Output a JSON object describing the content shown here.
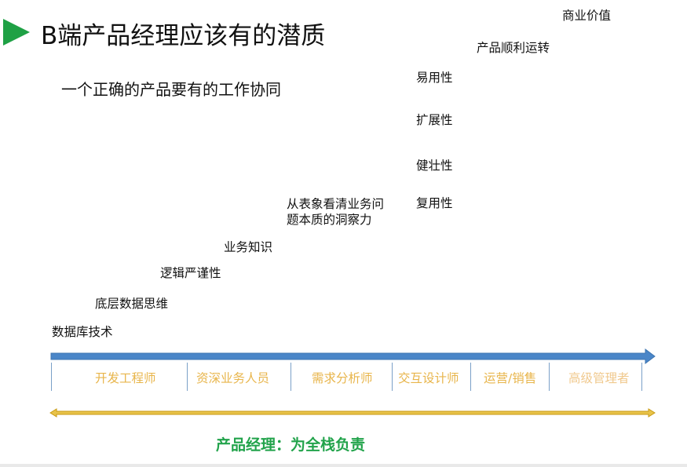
{
  "slide": {
    "title": "B端产品经理应该有的潜质",
    "subtitle": "一个正确的产品要有的工作协同"
  },
  "skills": [
    "数据库技术",
    "底层数据思维",
    "逻辑严谨性",
    "业务知识",
    "从表象看清业务问题本质的洞察力",
    "复用性",
    "健壮性",
    "扩展性",
    "易用性",
    "产品顺利运转",
    "商业价值"
  ],
  "roles": [
    "开发工程师",
    "资深业务人员",
    "需求分析师",
    "交互设计师",
    "运营/销售",
    "高级管理者"
  ],
  "footer": "产品经理：为全栈负责",
  "colors": {
    "accent_green": "#1fa145",
    "arrow_blue": "#4a86c8",
    "role_text": "#e8b54b",
    "gold_bar": "#d4a21a",
    "footer_green": "#22a34b"
  }
}
